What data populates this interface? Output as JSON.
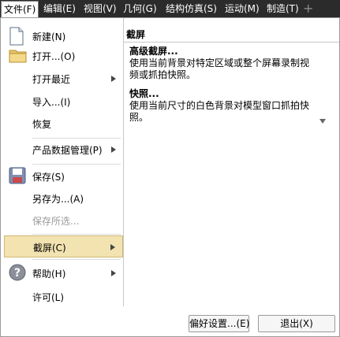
{
  "menubar": {
    "items": [
      {
        "label": "文件(F)"
      },
      {
        "label": "编辑(E)"
      },
      {
        "label": "视图(V)"
      },
      {
        "label": "几何(G)"
      },
      {
        "label": "结构仿真(S)"
      },
      {
        "label": "运动(M)"
      },
      {
        "label": "制造(T)"
      }
    ],
    "add_symbol": "+"
  },
  "file_menu": {
    "items": [
      {
        "label": "新建(N)",
        "icon": "new-document-icon"
      },
      {
        "label": "打开...(O)",
        "icon": "open-folder-icon"
      },
      {
        "label": "打开最近",
        "submenu": true
      },
      {
        "label": "导入...(I)"
      },
      {
        "label": "恢复"
      },
      {
        "label": "产品数据管理(P)",
        "submenu": true
      },
      {
        "label": "保存(S)",
        "icon": "save-disk-icon"
      },
      {
        "label": "另存为...(A)"
      },
      {
        "label": "保存所选...",
        "disabled": true
      },
      {
        "label": "截屏(C)",
        "submenu": true,
        "selected": true
      },
      {
        "label": "帮助(H)",
        "icon": "help-icon",
        "submenu": true
      },
      {
        "label": "许可(L)"
      }
    ]
  },
  "submenu": {
    "title": "截屏",
    "entries": [
      {
        "title": "高级截屏...",
        "description": "使用当前背景对特定区域或整个屏幕录制视频或抓拍快照。"
      },
      {
        "title": "快照...",
        "description": "使用当前尺寸的白色背景对模型窗口抓拍快照。"
      }
    ]
  },
  "footer": {
    "preferences_label": "偏好设置...(E)",
    "exit_label": "退出(X)"
  },
  "colors": {
    "menubar_bg": "#2b2b2b",
    "selected_bg": "#f2e3b0"
  }
}
